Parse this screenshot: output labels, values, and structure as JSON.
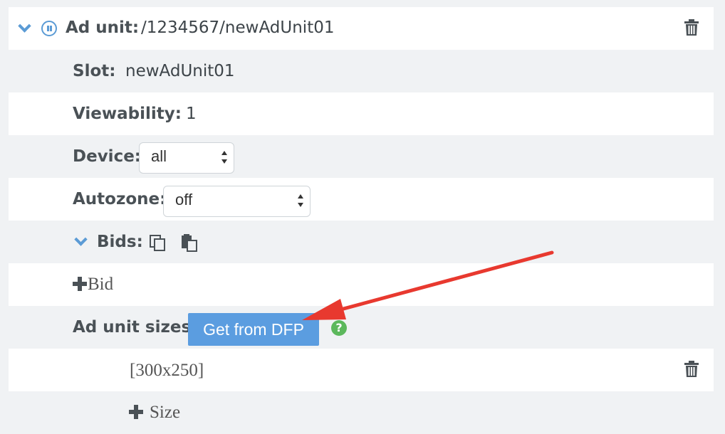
{
  "ad_unit": {
    "label": "Ad unit:",
    "path": "/1234567/newAdUnit01",
    "icons": {
      "expand": "chevron-down-icon",
      "status": "pause-icon",
      "delete": "trash-icon"
    }
  },
  "slot": {
    "label": "Slot:",
    "value": "newAdUnit01"
  },
  "viewability": {
    "label": "Viewability:",
    "value": "1"
  },
  "device": {
    "label": "Device:",
    "selected": "all"
  },
  "autozone": {
    "label": "Autozone:",
    "selected": "off"
  },
  "bids": {
    "label": "Bids:",
    "icons": {
      "expand": "chevron-down-icon",
      "copy": "copy-icon",
      "paste": "paste-icon"
    },
    "add_label": "Bid"
  },
  "ad_unit_sizes": {
    "label": "Ad unit sizes:",
    "button": "Get from DFP",
    "help": "?",
    "sizes": [
      "[300x250]"
    ],
    "add_label": "Size"
  },
  "colors": {
    "accent": "#5b9bd5",
    "button": "#5b9de0",
    "help": "#5cb85c",
    "annotation_arrow": "#e8392f"
  }
}
